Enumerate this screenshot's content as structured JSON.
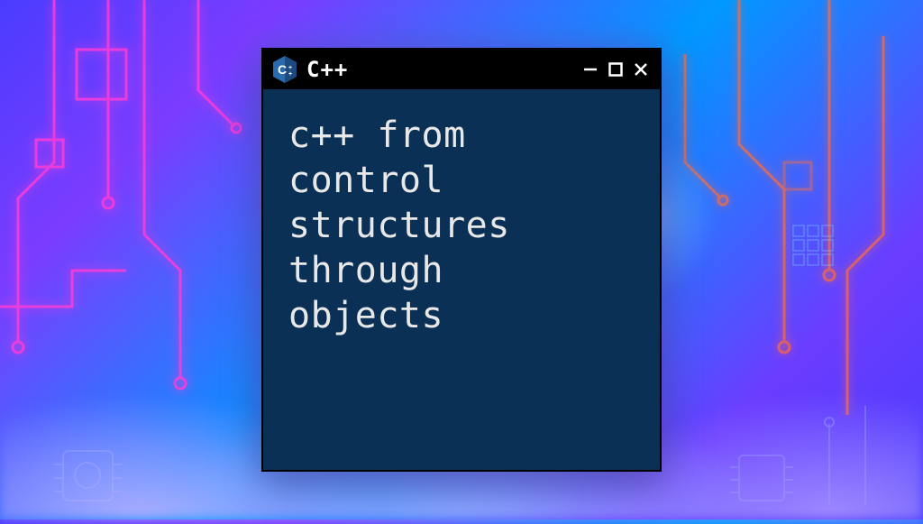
{
  "window": {
    "title": "C++",
    "icon": "cpp-hexagon-icon",
    "controls": {
      "minimize": "minimize",
      "maximize": "maximize",
      "close": "close"
    }
  },
  "content": {
    "body_text": "c++ from\ncontrol\nstructures\nthrough\nobjects"
  },
  "colors": {
    "window_bg": "#0a3055",
    "titlebar_bg": "#000000",
    "text": "#e8e8e8",
    "icon_primary": "#2a6bb0",
    "icon_secondary": "#1a4a80"
  }
}
